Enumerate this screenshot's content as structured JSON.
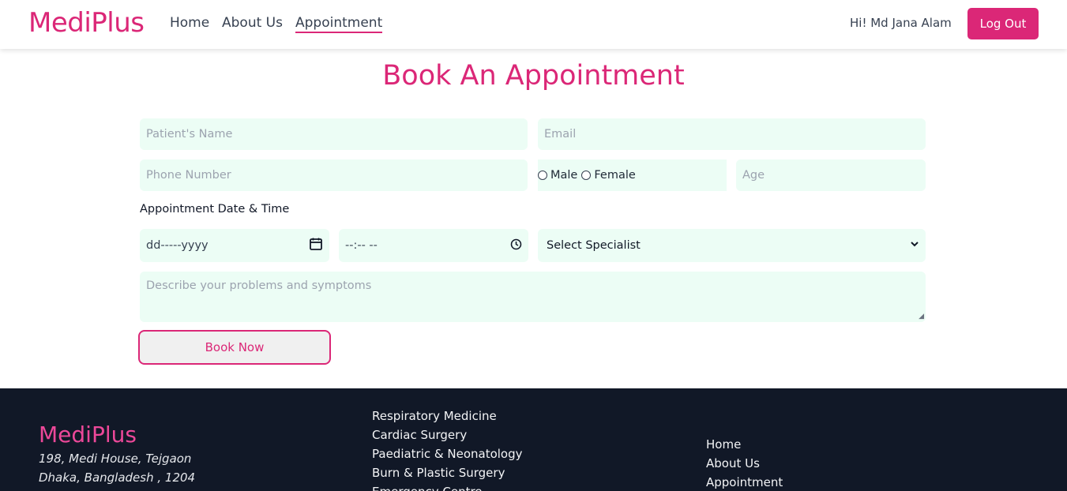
{
  "header": {
    "brand": "MediPlus",
    "nav": [
      {
        "label": "Home"
      },
      {
        "label": "About Us"
      },
      {
        "label": "Appointment"
      }
    ],
    "greeting": "Hi! Md Jana Alam",
    "logout_label": "Log Out"
  },
  "form": {
    "title": "Book An Appointment",
    "patient_name_placeholder": "Patient's Name",
    "email_placeholder": "Email",
    "phone_placeholder": "Phone Number",
    "gender_options": [
      "Male",
      "Female"
    ],
    "age_placeholder": "Age",
    "datetime_label": "Appointment Date & Time",
    "date_value": "dd-----yyyy",
    "time_value": "--:-- --",
    "specialist_selected": "Select Specialist",
    "symptoms_placeholder": "Describe your problems and symptoms",
    "submit_label": "Book Now"
  },
  "footer": {
    "brand": "MediPlus",
    "address_line1": "198, Medi House, Tejgaon",
    "address_line2": "Dhaka, Bangladesh , 1204",
    "services": [
      "Respiratory Medicine",
      "Cardiac Surgery",
      "Paediatric & Neonatology",
      "Burn & Plastic Surgery",
      "Emergency Centre"
    ],
    "links": [
      "Home",
      "About Us",
      "Appointment"
    ]
  },
  "colors": {
    "accent": "#db2777",
    "field_bg": "#ecfdf5",
    "footer_bg": "#111827"
  }
}
